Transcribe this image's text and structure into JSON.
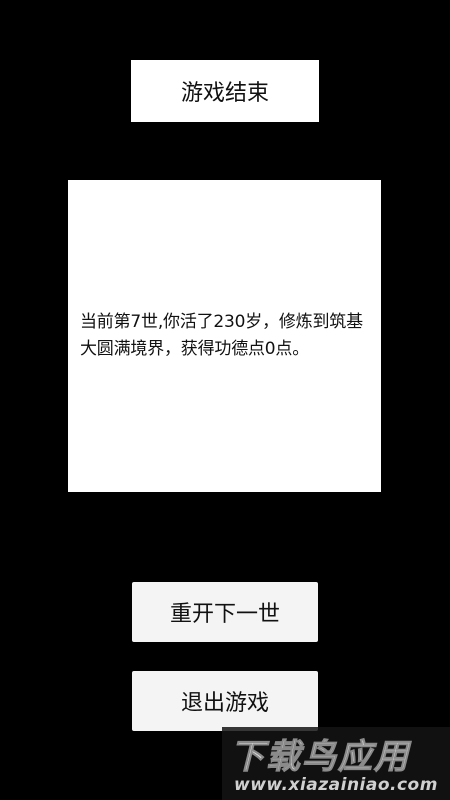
{
  "title": "游戏结束",
  "message": "当前第7世,你活了230岁，修炼到筑基大圆满境界，获得功德点0点。",
  "buttons": {
    "next_life": "重开下一世",
    "quit": "退出游戏"
  },
  "watermark": {
    "brand": "下载鸟应用",
    "url": "www.xiazainiao.com"
  },
  "colors": {
    "background": "#000000",
    "panel": "#ffffff",
    "button": "#f4f4f4",
    "text": "#111111"
  }
}
